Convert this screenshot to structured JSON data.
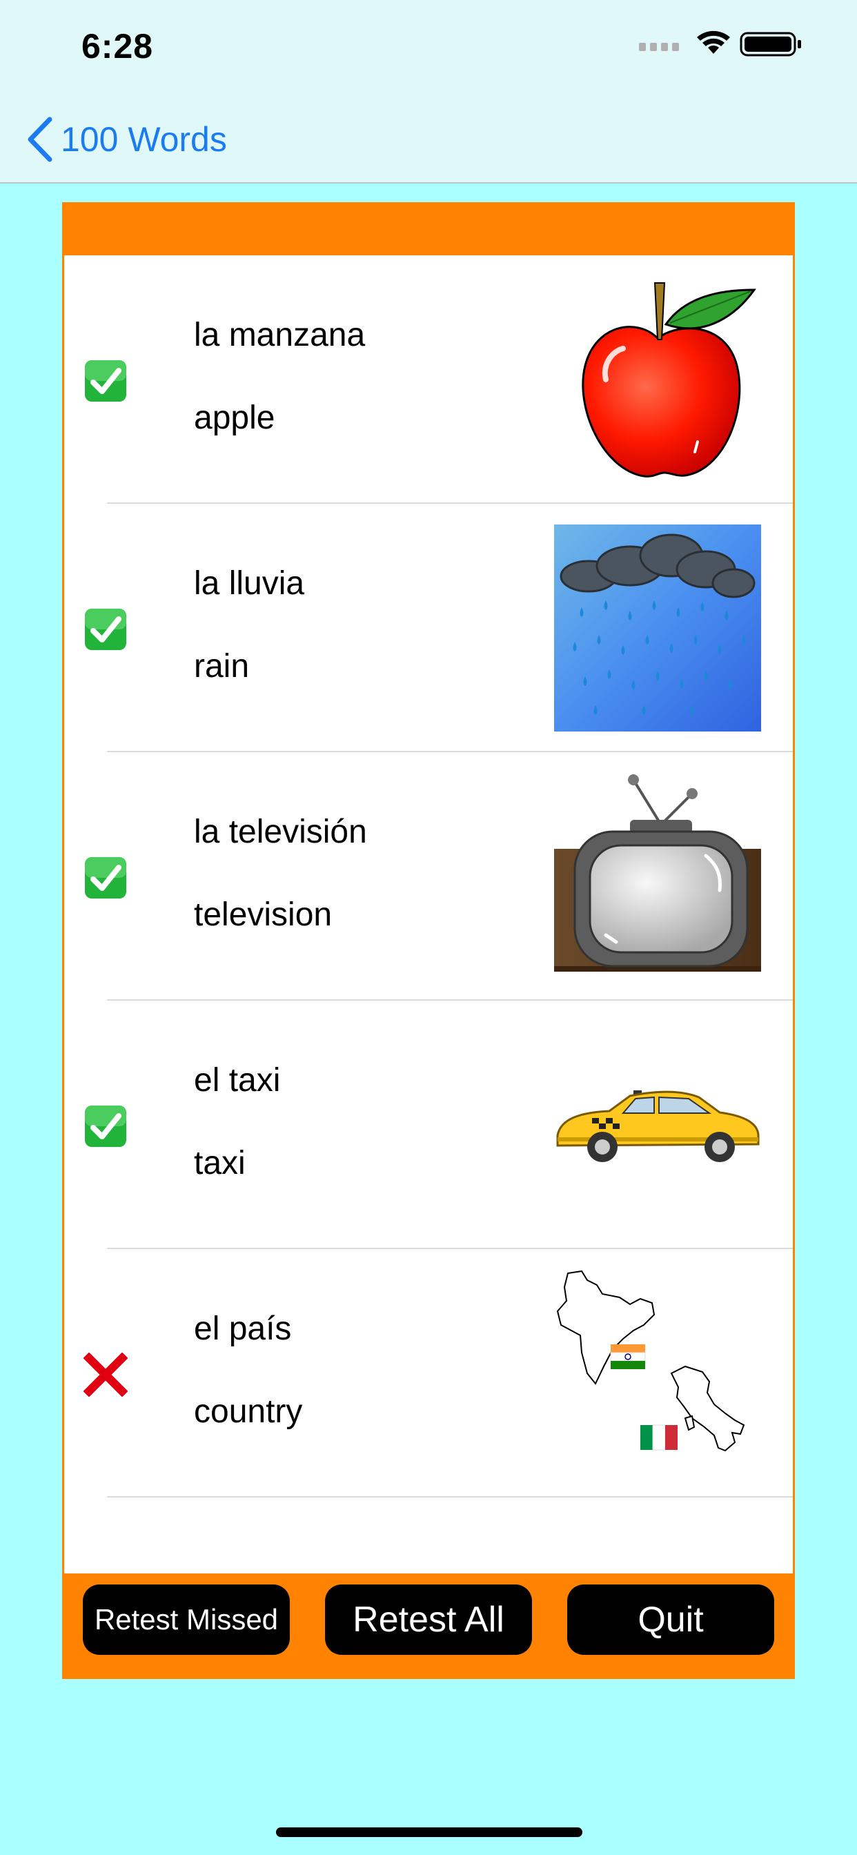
{
  "status_bar": {
    "time": "6:28"
  },
  "nav": {
    "back_label": "100 Words"
  },
  "items": [
    {
      "spanish": "la manzana",
      "english": "apple",
      "result": "correct",
      "image": "apple-image"
    },
    {
      "spanish": "la lluvia",
      "english": "rain",
      "result": "correct",
      "image": "rain-image"
    },
    {
      "spanish": "la televisión",
      "english": "television",
      "result": "correct",
      "image": "television-image"
    },
    {
      "spanish": "el taxi",
      "english": "taxi",
      "result": "correct",
      "image": "taxi-image"
    },
    {
      "spanish": "el país",
      "english": "country",
      "result": "incorrect",
      "image": "country-image"
    }
  ],
  "buttons": {
    "retest_missed": "Retest Missed",
    "retest_all": "Retest All",
    "quit": "Quit"
  },
  "colors": {
    "background": "#aaffff",
    "bars": "#e0f8f8",
    "accent": "#ff8200",
    "link": "#1a7cf0",
    "correct": "#22b33a",
    "incorrect": "#e00010"
  }
}
